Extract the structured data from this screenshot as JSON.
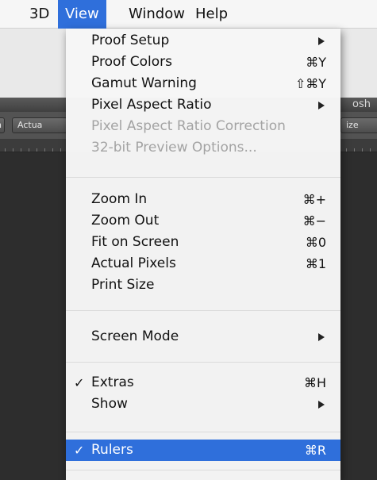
{
  "menubar": {
    "items": [
      {
        "label": "3D"
      },
      {
        "label": "View"
      },
      {
        "label": "Window"
      },
      {
        "label": "Help"
      }
    ]
  },
  "app": {
    "title_partial": "osh",
    "options_buttons": [
      {
        "label": "n"
      },
      {
        "label": "Actua"
      },
      {
        "label": "ize"
      }
    ]
  },
  "view_menu": {
    "proof_setup": {
      "label": "Proof Setup",
      "submenu": true
    },
    "proof_colors": {
      "label": "Proof Colors",
      "shortcut": "⌘Y"
    },
    "gamut_warning": {
      "label": "Gamut Warning",
      "shortcut": "⇧⌘Y"
    },
    "pixel_aspect_ratio": {
      "label": "Pixel Aspect Ratio",
      "submenu": true
    },
    "pixel_aspect_ratio_correction": {
      "label": "Pixel Aspect Ratio Correction",
      "disabled": true
    },
    "preview_options": {
      "label": "32-bit Preview Options...",
      "disabled": true
    },
    "zoom_in": {
      "label": "Zoom In",
      "shortcut": "⌘+"
    },
    "zoom_out": {
      "label": "Zoom Out",
      "shortcut": "⌘−"
    },
    "fit_on_screen": {
      "label": "Fit on Screen",
      "shortcut": "⌘0"
    },
    "actual_pixels": {
      "label": "Actual Pixels",
      "shortcut": "⌘1"
    },
    "print_size": {
      "label": "Print Size"
    },
    "screen_mode": {
      "label": "Screen Mode",
      "submenu": true
    },
    "extras": {
      "label": "Extras",
      "shortcut": "⌘H",
      "checked": true,
      "check_mark": "✓"
    },
    "show": {
      "label": "Show",
      "submenu": true
    },
    "rulers": {
      "label": "Rulers",
      "shortcut": "⌘R",
      "checked": true,
      "check_mark": "✓",
      "highlighted": true
    }
  },
  "colors": {
    "highlight": "#2f6fdb",
    "menu_bg": "#f6f6f6",
    "disabled_text": "#a3a3a3",
    "app_dark": "#2b2b2b"
  }
}
